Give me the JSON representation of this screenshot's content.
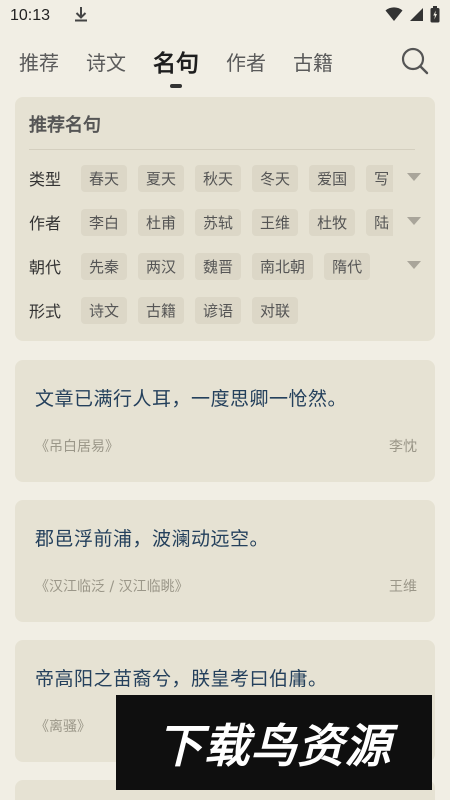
{
  "status_bar": {
    "time": "10:13"
  },
  "nav": {
    "tabs": [
      {
        "label": "推荐"
      },
      {
        "label": "诗文"
      },
      {
        "label": "名句"
      },
      {
        "label": "作者"
      },
      {
        "label": "古籍"
      }
    ],
    "active_tab": "名句"
  },
  "filter": {
    "title": "推荐名句",
    "rows": [
      {
        "label": "类型",
        "chips": [
          "春天",
          "夏天",
          "秋天",
          "冬天",
          "爱国",
          "写"
        ]
      },
      {
        "label": "作者",
        "chips": [
          "李白",
          "杜甫",
          "苏轼",
          "王维",
          "杜牧",
          "陆"
        ]
      },
      {
        "label": "朝代",
        "chips": [
          "先秦",
          "两汉",
          "魏晋",
          "南北朝",
          "隋代"
        ]
      },
      {
        "label": "形式",
        "chips": [
          "诗文",
          "古籍",
          "谚语",
          "对联"
        ]
      }
    ]
  },
  "quotes": [
    {
      "text": "文章已满行人耳，一度思卿一怆然。",
      "source": "《吊白居易》",
      "author": "李忱"
    },
    {
      "text": "郡邑浮前浦，波澜动远空。",
      "source": "《汉江临泛 / 汉江临眺》",
      "author": "王维"
    },
    {
      "text": "帝高阳之苗裔兮，朕皇考曰伯庸。",
      "source": "《离骚》",
      "author": ""
    }
  ],
  "watermark": {
    "text": "下载鸟资源"
  },
  "colors": {
    "background": "#f1eee4",
    "card": "#e6e2d3",
    "quote_text": "#24405c"
  }
}
